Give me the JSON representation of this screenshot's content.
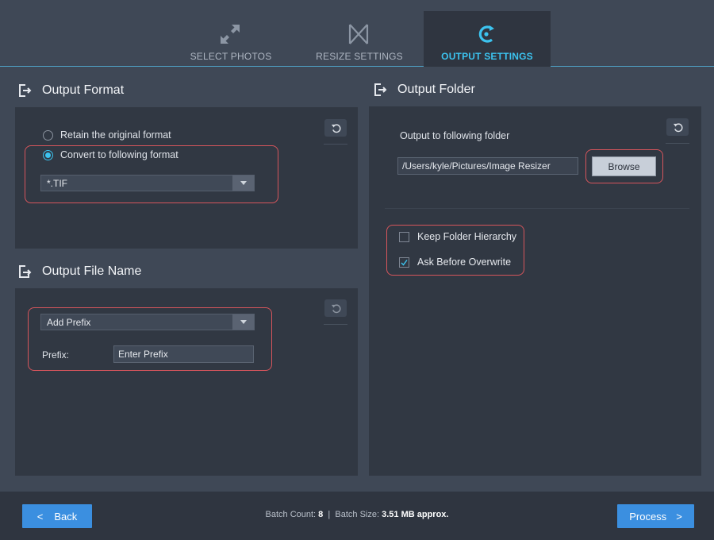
{
  "tabs": [
    {
      "label": "SELECT PHOTOS",
      "icon": "expand-arrows-icon"
    },
    {
      "label": "RESIZE SETTINGS",
      "icon": "resize-bowtie-icon"
    },
    {
      "label": "OUTPUT SETTINGS",
      "icon": "output-c-icon",
      "active": true
    }
  ],
  "output_format": {
    "title": "Output Format",
    "retain_label": "Retain the original format",
    "convert_label": "Convert to  following format",
    "selected_option": "convert",
    "format_value": "*.TIF"
  },
  "output_file_name": {
    "title": "Output File Name",
    "mode_value": "Add Prefix",
    "prefix_label": "Prefix:",
    "prefix_placeholder": "Enter Prefix"
  },
  "output_folder": {
    "title": "Output Folder",
    "folder_label": "Output to following folder",
    "folder_path": "/Users/kyle/Pictures/Image Resizer",
    "browse_label": "Browse",
    "keep_hierarchy_label": "Keep Folder Hierarchy",
    "keep_hierarchy_checked": false,
    "ask_overwrite_label": "Ask Before Overwrite",
    "ask_overwrite_checked": true
  },
  "footer": {
    "back_label": "Back",
    "process_label": "Process",
    "batch_count_label": "Batch Count:",
    "batch_count_value": "8",
    "separator": "|",
    "batch_size_label": "Batch Size:",
    "batch_size_value": "3.51 MB approx."
  },
  "colors": {
    "accent": "#3cc3ef",
    "button_blue": "#3b8fe0",
    "highlight_red": "#d6555c",
    "panel_bg": "#313843",
    "window_bg": "#3f4856"
  }
}
